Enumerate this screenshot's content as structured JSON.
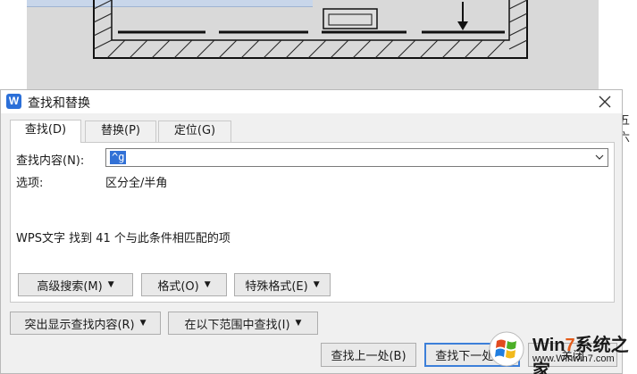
{
  "background": {
    "text_fragment": "五六"
  },
  "dialog": {
    "app_icon_letter": "W",
    "title": "查找和替换",
    "tabs": [
      {
        "label": "查找(D)"
      },
      {
        "label": "替换(P)"
      },
      {
        "label": "定位(G)"
      }
    ],
    "find_label": "查找内容(N):",
    "find_value": "^g",
    "options_label": "选项:",
    "options_value": "区分全/半角",
    "result_text": "WPS文字 找到 41 个与此条件相匹配的项",
    "advanced_search_label": "高级搜索(M)",
    "format_label": "格式(O)",
    "special_format_label": "特殊格式(E)",
    "highlight_label": "突出显示查找内容(R)",
    "find_in_label": "在以下范围中查找(I)",
    "find_prev_label": "查找上一处(B)",
    "find_next_label": "查找下一处(F)",
    "close_label": "关闭"
  },
  "watermark": {
    "brand_prefix": "Win",
    "brand_num": "7",
    "brand_suffix": "系统之家",
    "url": "www.Winwin7.com"
  },
  "colors": {
    "accent": "#3271d6",
    "dialog_bg": "#f0f0f0",
    "button_bg": "#e9e9e9",
    "default_button_border": "#3c7fd9",
    "watermark_orange": "#e25b1a"
  }
}
